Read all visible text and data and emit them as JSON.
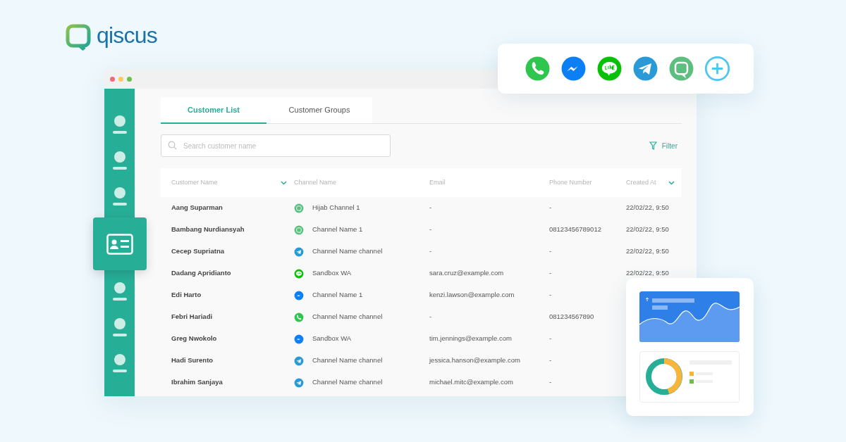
{
  "logo": {
    "text": "qiscus"
  },
  "sidebar": {
    "items": [
      {
        "selected": false
      },
      {
        "selected": false
      },
      {
        "selected": false
      },
      {
        "selected": true
      },
      {
        "selected": false
      },
      {
        "selected": false
      },
      {
        "selected": false
      }
    ]
  },
  "tabs": [
    {
      "label": "Customer List",
      "selected": true
    },
    {
      "label": "Customer Groups",
      "selected": false
    }
  ],
  "search": {
    "placeholder": "Search customer name"
  },
  "filter": {
    "label": "Filter"
  },
  "table": {
    "columns": [
      {
        "label": "Customer Name",
        "sorted": true
      },
      {
        "label": "Channel Name",
        "sorted": false
      },
      {
        "label": "Email",
        "sorted": false
      },
      {
        "label": "Phone Number",
        "sorted": false
      },
      {
        "label": "Created At",
        "sorted": true
      }
    ],
    "rows": [
      {
        "name": "Aang Suparman",
        "kind": "qiscus",
        "channel": "Hijab Channel 1",
        "email": "-",
        "phone": "-",
        "created_at": "22/02/22, 9:50"
      },
      {
        "name": "Bambang Nurdiansyah",
        "kind": "qiscus",
        "channel": "Channel Name 1",
        "email": "-",
        "phone": "08123456789012",
        "created_at": "22/02/22, 9:50"
      },
      {
        "name": "Cecep Supriatna",
        "kind": "telegram",
        "channel": "Channel Name channel",
        "email": "-",
        "phone": "-",
        "created_at": "22/02/22, 9:50"
      },
      {
        "name": "Dadang Apridianto",
        "kind": "line",
        "channel": "Sandbox WA",
        "email": "sara.cruz@example.com",
        "phone": "-",
        "created_at": "22/02/22, 9:50"
      },
      {
        "name": "Edi Harto",
        "kind": "messenger",
        "channel": "Channel Name 1",
        "email": "kenzi.lawson@example.com",
        "phone": "-"
      },
      {
        "name": "Febri Hariadi",
        "kind": "whatsapp",
        "channel": "Channel Name channel",
        "email": "-",
        "phone": "081234567890"
      },
      {
        "name": "Greg Nwokolo",
        "kind": "messenger",
        "channel": "Sandbox WA",
        "email": "tim.jennings@example.com",
        "phone": "-"
      },
      {
        "name": "Hadi Surento",
        "kind": "telegram",
        "channel": "Channel Name channel",
        "email": "jessica.hanson@example.com",
        "phone": "-"
      },
      {
        "name": "Ibrahim Sanjaya",
        "kind": "telegram",
        "channel": "Channel Name channel",
        "email": "michael.mitc@example.com",
        "phone": "-"
      }
    ]
  },
  "channels_card": {
    "channels": [
      {
        "kind": "whatsapp"
      },
      {
        "kind": "messenger"
      },
      {
        "kind": "line"
      },
      {
        "kind": "telegram"
      },
      {
        "kind": "qiscus"
      },
      {
        "kind": "add"
      }
    ]
  }
}
